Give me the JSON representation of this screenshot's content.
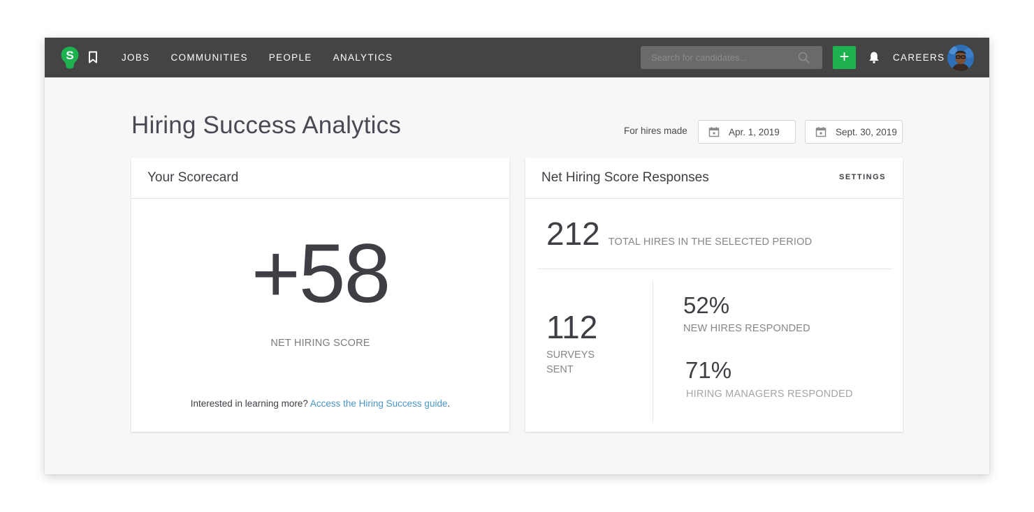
{
  "nav": {
    "logo_letter": "S",
    "links": [
      "JOBS",
      "COMMUNITIES",
      "PEOPLE",
      "ANALYTICS"
    ],
    "search_placeholder": "Search for candidates...",
    "add_label": "+",
    "careers_label": "CAREERS",
    "icons": {
      "logo": "s-bulb-logo-icon",
      "bookmark": "bookmark-icon",
      "search": "search-icon",
      "bell": "bell-icon"
    }
  },
  "colors": {
    "nav_bg": "#444444",
    "brand_green": "#1eb14f",
    "link_blue": "#4a96c9"
  },
  "header": {
    "title": "Hiring Success Analytics",
    "date_label": "For hires made",
    "start_date": "Apr. 1, 2019",
    "end_date": "Sept. 30, 2019"
  },
  "scorecard": {
    "title": "Your Scorecard",
    "score": "+58",
    "score_label": "NET HIRING SCORE",
    "learn_more_text": "Interested in learning more?",
    "learn_more_link": "Access the Hiring Success guide",
    "learn_more_suffix": "."
  },
  "responses": {
    "title": "Net Hiring Score Responses",
    "settings_label": "SETTINGS",
    "total_hires": "212",
    "total_hires_label": "TOTAL HIRES IN THE SELECTED PERIOD",
    "surveys_sent": "112",
    "surveys_sent_label": "SURVEYS SENT",
    "new_hires_pct": "52%",
    "new_hires_label": "NEW HIRES RESPONDED",
    "managers_pct": "71%",
    "managers_label": "HIRING MANAGERS RESPONDED"
  }
}
